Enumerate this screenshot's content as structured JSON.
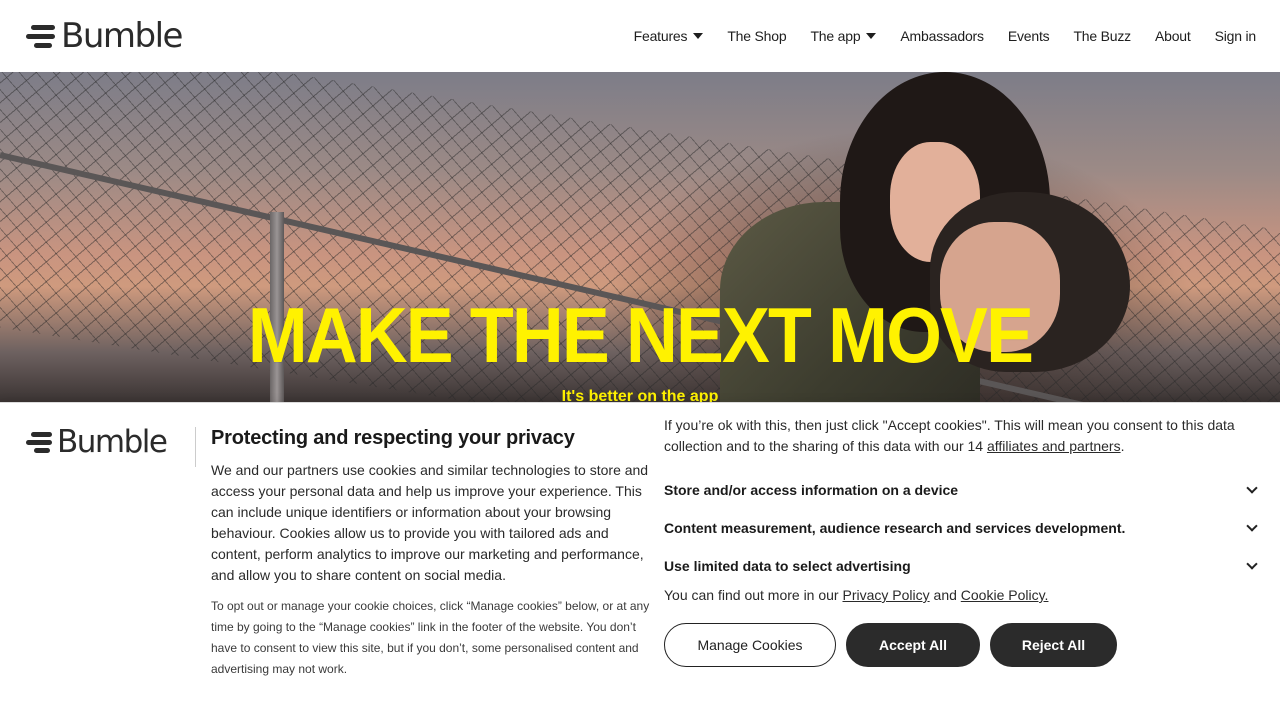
{
  "header": {
    "logo_text": "Bumble",
    "nav": [
      {
        "label": "Features",
        "has_dropdown": true
      },
      {
        "label": "The Shop",
        "has_dropdown": false
      },
      {
        "label": "The app",
        "has_dropdown": true
      },
      {
        "label": "Ambassadors",
        "has_dropdown": false
      },
      {
        "label": "Events",
        "has_dropdown": false
      },
      {
        "label": "The Buzz",
        "has_dropdown": false
      },
      {
        "label": "About",
        "has_dropdown": false
      },
      {
        "label": "Sign in",
        "has_dropdown": false
      }
    ]
  },
  "hero": {
    "title": "MAKE THE NEXT MOVE",
    "subtitle": "It's better on the app",
    "title_color": "#fff200"
  },
  "cookie_banner": {
    "logo_text": "Bumble",
    "title": "Protecting and respecting your privacy",
    "body": "We and our partners use cookies and similar technologies to store and access your personal data and help us improve your experience. This can include unique identifiers or information about your browsing behaviour. Cookies allow us to provide you with tailored ads and content, perform analytics to improve our marketing and performance, and allow you to share content on social media.",
    "small_print": "To opt out or manage your cookie choices, click “Manage cookies” below, or at any time by going to the “Manage cookies” link in the footer of the website. You don’t have to consent to view this site, but if you don’t, some personalised content and advertising may not work.",
    "consent_text_pre": "If you’re ok with this, then just click \"Accept cookies\". This will mean you consent to this data collection and to the sharing of this data with our 14 ",
    "consent_link": "affiliates and partners",
    "consent_text_post": ".",
    "accordion": [
      {
        "label": "Store and/or access information on a device"
      },
      {
        "label": "Content measurement, audience research and services development."
      },
      {
        "label": "Use limited data to select advertising"
      }
    ],
    "links_pre": "You can find out more in our ",
    "privacy_link": "Privacy Policy",
    "links_mid": " and ",
    "cookie_link": "Cookie Policy.",
    "buttons": {
      "manage": "Manage Cookies",
      "accept": "Accept All",
      "reject": "Reject All"
    }
  },
  "colors": {
    "dark_button": "#2b2b2b",
    "accent_yellow": "#fff200"
  }
}
